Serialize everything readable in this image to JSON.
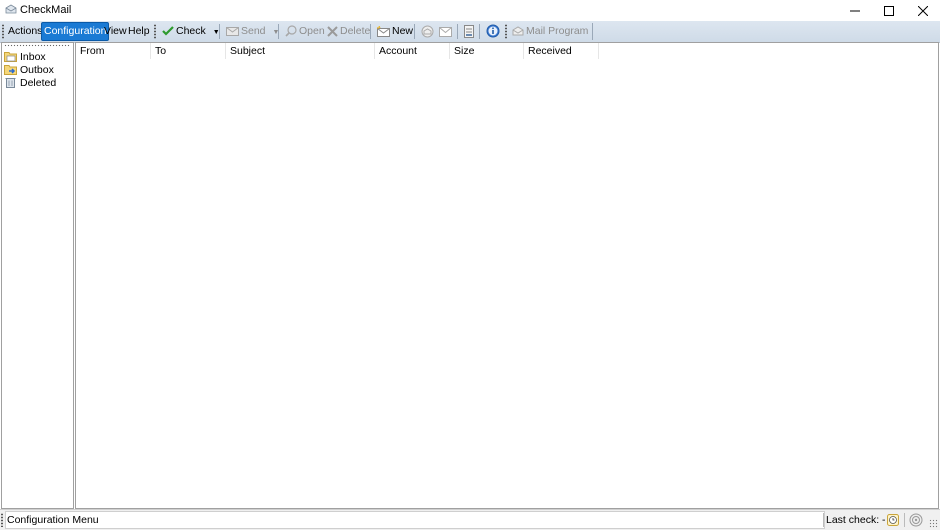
{
  "window": {
    "title": "CheckMail",
    "controls": {
      "minimize": "—",
      "maximize": "☐",
      "close": "✕"
    }
  },
  "toolbar": {
    "menus": [
      {
        "label": "Actions",
        "active": false
      },
      {
        "label": "Configuration",
        "active": true
      },
      {
        "label": "View",
        "active": false
      },
      {
        "label": "Help",
        "active": false
      }
    ],
    "buttons": {
      "check": {
        "label": "Check",
        "icon": "checkmark-icon",
        "dropdown": "▼",
        "enabled": true
      },
      "send": {
        "label": "Send",
        "icon": "send-icon",
        "dropdown": "▼",
        "enabled": false
      },
      "open": {
        "label": "Open",
        "icon": "magnifier-icon",
        "enabled": false
      },
      "delete": {
        "label": "Delete",
        "icon": "delete-x-icon",
        "enabled": false
      },
      "new": {
        "label": "New",
        "icon": "new-mail-icon",
        "enabled": true
      },
      "reply": {
        "icon": "reply-icon",
        "enabled": false
      },
      "mail": {
        "icon": "envelope-icon",
        "enabled": false
      },
      "log": {
        "icon": "document-icon",
        "enabled": true
      },
      "info": {
        "icon": "info-icon",
        "enabled": true
      },
      "mail_program": {
        "label": "Mail Program",
        "icon": "mail-program-icon",
        "enabled": false
      }
    }
  },
  "folders": [
    {
      "label": "Inbox",
      "icon": "inbox-folder-icon"
    },
    {
      "label": "Outbox",
      "icon": "outbox-folder-icon"
    },
    {
      "label": "Deleted",
      "icon": "trash-icon"
    }
  ],
  "message_list": {
    "columns": [
      "From",
      "To",
      "Subject",
      "Account",
      "Size",
      "Received"
    ],
    "rows": []
  },
  "statusbar": {
    "message": "Configuration Menu",
    "last_check": "Last check: -"
  }
}
